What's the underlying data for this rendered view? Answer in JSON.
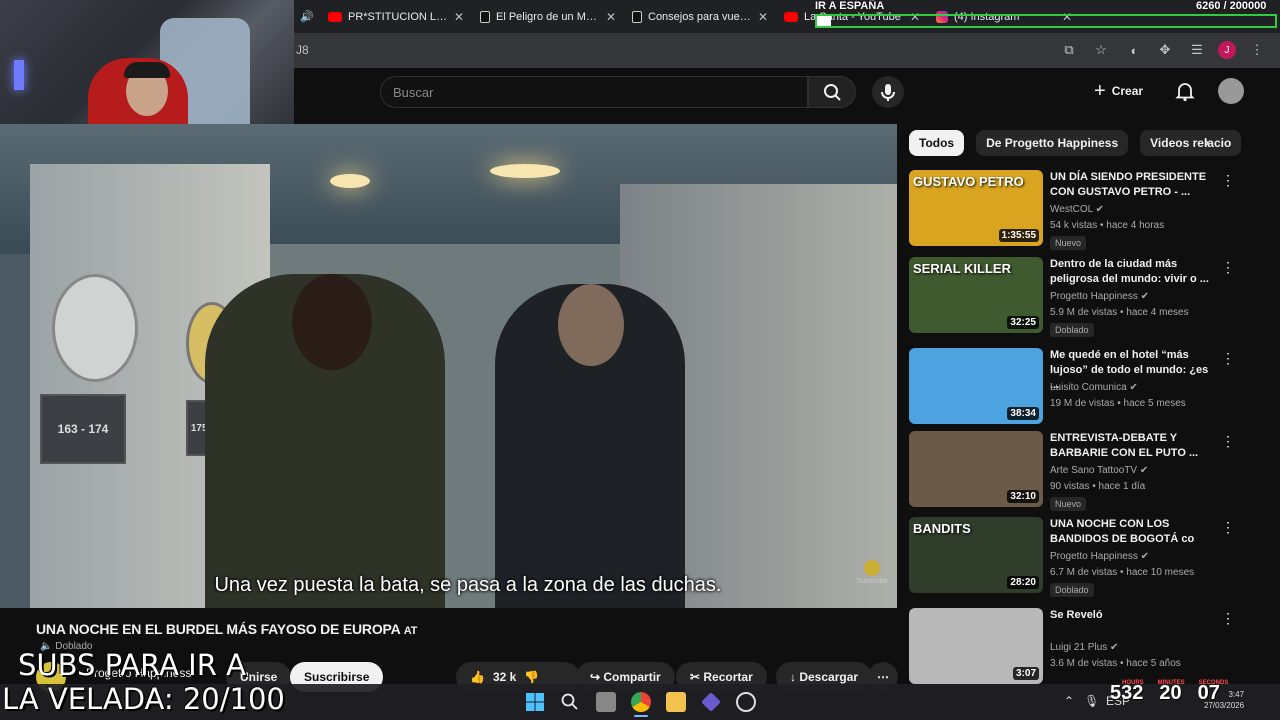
{
  "browser": {
    "tabs": [
      {
        "title": "PR*STITUCION LEGAL (",
        "icon": "youtube-icon"
      },
      {
        "title": "El Peligro de un Monta",
        "icon": "tiktok-icon"
      },
      {
        "title": "Consejos para vuelos c",
        "icon": "tiktok-icon"
      },
      {
        "title": "La Santa - YouTube",
        "icon": "youtube-icon"
      },
      {
        "title": "(4) Instagram",
        "icon": "instagram-icon"
      }
    ],
    "url_fragment": "J8",
    "profile_initial": "J"
  },
  "youtube": {
    "search_placeholder": "Buscar",
    "create_label": "Crear",
    "subtitle": "Una vez puesta la bata, se pasa a la zona de las duchas.",
    "subscribe_watermark": "Subscribe",
    "video_title": "UNA NOCHE EN EL BURDEL MÁS FAYOSO DE EUROPA",
    "title_fragment": "AT",
    "dubbed_chip": "Doblado",
    "channel_name": "Progetto Happiness",
    "join_label": "Unirse",
    "subscribe_label": "Suscribirse",
    "like_count": "32 k",
    "share_label": "Compartir",
    "clip_label": "Recortar",
    "download_label": "Descargar",
    "chips": [
      "Todos",
      "De Progetto Happiness",
      "Videos relacio"
    ],
    "recommendations": [
      {
        "title": "UN DÍA SIENDO PRESIDENTE CON GUSTAVO PETRO - ...",
        "channel": "WestCOL",
        "meta": "54 k vistas • hace 4 horas",
        "badge": "Nuevo",
        "duration": "1:35:55",
        "thumb_text": "GUSTAVO PETRO",
        "thumb_color": "#d9a520"
      },
      {
        "title": "Dentro de la ciudad más peligrosa del mundo: vivir o ...",
        "channel": "Progetto Happiness",
        "meta": "5.9 M de vistas • hace 4 meses",
        "badge": "Doblado",
        "duration": "32:25",
        "thumb_text": "SERIAL KILLER",
        "thumb_color": "#3e5a2e"
      },
      {
        "title": "Me quedé en el hotel “más lujoso” de todo el mundo: ¿es ...",
        "channel": "Luisito Comunica",
        "meta": "19 M de vistas • hace 5 meses",
        "badge": "",
        "duration": "38:34",
        "thumb_text": "",
        "thumb_color": "#4da3e0"
      },
      {
        "title": "ENTREVISTA-DEBATE Y BARBARIE CON EL PUTO ...",
        "channel": "Arte Sano TattooTV",
        "meta": "90 vistas • hace 1 día",
        "badge": "Nuevo",
        "duration": "32:10",
        "thumb_text": "",
        "thumb_color": "#6b5a48"
      },
      {
        "title": "UNA NOCHE CON LOS BANDIDOS DE BOGOTÁ co",
        "channel": "Progetto Happiness",
        "meta": "6.7 M de vistas • hace 10 meses",
        "badge": "Doblado",
        "duration": "28:20",
        "thumb_text": "BANDITS",
        "thumb_color": "#2f3d2a"
      },
      {
        "title": "Se Reveló",
        "channel": "Luigi 21 Plus",
        "meta": "3.6 M de vistas • hace 5 años",
        "badge": "",
        "duration": "3:07",
        "thumb_text": "",
        "thumb_color": "#b8b8b8"
      }
    ]
  },
  "overlay": {
    "goal_label": "IR A ESPAÑA",
    "goal_count": "6260  / 200000",
    "goal_fraction": 0.0313,
    "subs_line1": "SUBS PARA IR A",
    "subs_line2": "LA VELADA: 20/100",
    "timer": [
      "532",
      "20",
      "07"
    ],
    "timer_labels": [
      "HOURS",
      "MINUTES",
      "SECONDS"
    ]
  },
  "taskbar": {
    "time": "3:47",
    "date": "27/03/2026",
    "lang": "ESP"
  },
  "colors": {
    "youtube_red": "#ff0000",
    "goal_green": "#2ecc40",
    "taskbar_accent": "#7ab8ff"
  }
}
